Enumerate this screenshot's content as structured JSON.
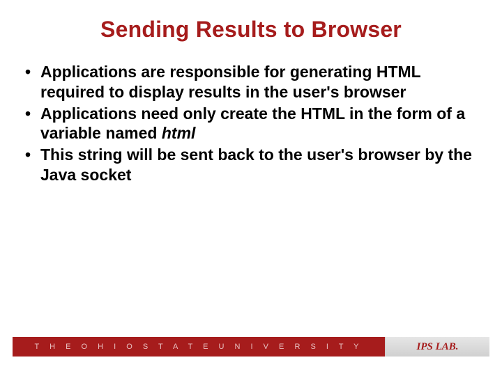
{
  "title": "Sending Results to Browser",
  "bullets": [
    {
      "pre": "Applications are responsible for generating HTML required to display results in the user's browser",
      "em": "",
      "post": ""
    },
    {
      "pre": "Applications need only create the HTML in the form of a variable named ",
      "em": "html",
      "post": ""
    },
    {
      "pre": "This string will be sent back to the user's browser by the Java socket",
      "em": "",
      "post": ""
    }
  ],
  "footer": {
    "university": "T H E   O H I O   S T A T E   U N I V E R S I T Y",
    "lab": "IPS LAB."
  }
}
